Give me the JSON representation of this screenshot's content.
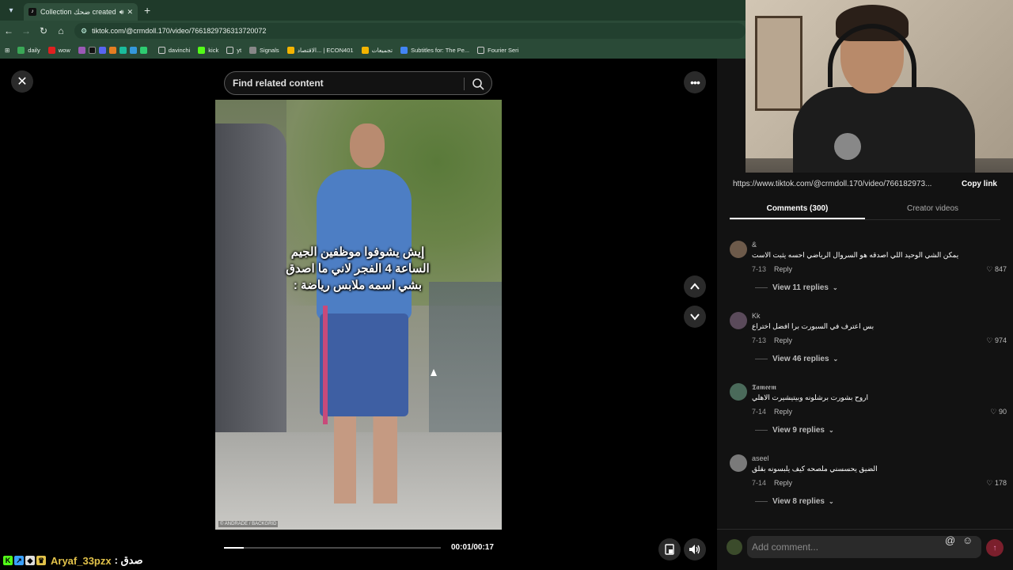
{
  "browser": {
    "tab_title": "Collection ضحك created by",
    "new_tab": "+",
    "url": "tiktok.com/@crmdoll.170/video/7661829736313720072",
    "bookmarks": [
      "daily",
      "wow",
      "davinchi",
      "kick",
      "yt",
      "Signals",
      "الاقتصاد... | ECON401",
      "تجميعات",
      "Subtitles for: The Pe...",
      "Fourier Seri"
    ]
  },
  "search": {
    "placeholder": "Find related content"
  },
  "video": {
    "caption": "إيش يشوفوا موظفين الجيم الساعة 4 الفجر لاني ما اصدق بشي اسمه ملابس رياضة :",
    "watermark": "© ANDRADE / BACKGRID",
    "time": "00:01/00:17",
    "progress": 0.09
  },
  "panel": {
    "share_url": "https://www.tiktok.com/@crmdoll.170/video/766182973...",
    "copy_link": "Copy link",
    "tabs": [
      "Comments (300)",
      "Creator videos"
    ],
    "comments": [
      {
        "name": "&",
        "text": "يمكن الشي الوحيد اللي اصدقه هو السروال الرياضي احسه يثبت الاست",
        "date": "7-13",
        "reply": "Reply",
        "likes": "847",
        "replies": "View 11 replies"
      },
      {
        "name": "Kk",
        "text": "بس اعترف في السبورت برا افضل اختراع",
        "date": "7-13",
        "reply": "Reply",
        "likes": "974",
        "replies": "View 46 replies"
      },
      {
        "name": "𝕿𝖆𝖒𝖊𝖊𝖒",
        "text": "اروح بشورت برشلونه وبيتيشيرت الاهلي",
        "date": "7-14",
        "reply": "Reply",
        "likes": "90",
        "replies": "View 9 replies"
      },
      {
        "name": "aseel",
        "text": "الضيق يحسسني ملصحه كيف يلبسونه بقلق",
        "date": "7-14",
        "reply": "Reply",
        "likes": "178",
        "replies": "View 8 replies"
      }
    ],
    "add_comment_placeholder": "Add comment..."
  },
  "chat": {
    "username": "Aryaf_33pzx",
    "message": ": صدق"
  },
  "colors": {
    "accent": "#fe2c55",
    "username": "#e2c24a"
  }
}
